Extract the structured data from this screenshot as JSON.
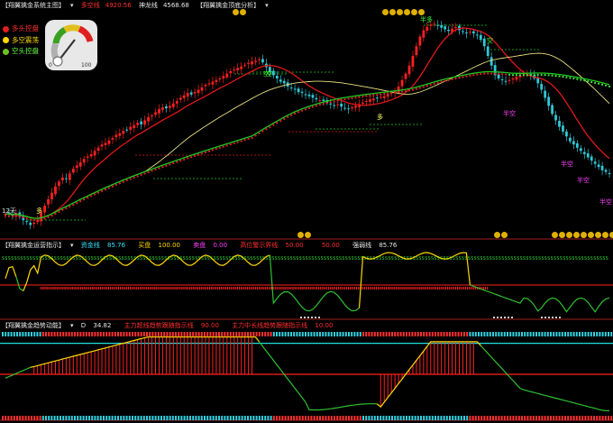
{
  "panel1": {
    "header": {
      "title": "【翔翼擒金系统主图】",
      "item1_label": "多空线",
      "item1_value": "4920.56",
      "item2_label": "神龙线",
      "item2_value": "4568.68",
      "subtitle": "【翔翼擒金顶底分析】"
    },
    "legend": [
      {
        "label": "多头控盘",
        "color": "#e02020"
      },
      {
        "label": "多空震荡",
        "color": "#ffd800"
      },
      {
        "label": "空头控盘",
        "color": "#6cc020"
      }
    ],
    "gauge": {
      "min": "0",
      "max": "100"
    },
    "timeframe": "12天",
    "annotations": [
      "多",
      "空",
      "多",
      "空",
      "半多",
      "空",
      "半空",
      "半空",
      "半空",
      "半空"
    ]
  },
  "panel2": {
    "header": {
      "title": "【翔翼擒金运营指示】",
      "items": [
        {
          "label": "资金线",
          "value": "85.76",
          "color": "#38e0ff"
        },
        {
          "label": "买盘",
          "value": "100.00",
          "color": "#ffd800"
        },
        {
          "label": "卖盘",
          "value": "0.00",
          "color": "#ff40ff"
        },
        {
          "label": "高位警示界线",
          "value": "50.00",
          "color": "#ff3030"
        },
        {
          "label": "",
          "value": "50.00",
          "color": "#ff3030"
        },
        {
          "label": "强弱线",
          "value": "85.76",
          "color": "#e6e6e6"
        }
      ]
    }
  },
  "panel3": {
    "header": {
      "title": "【翔翼擒金趋势动能】",
      "items": [
        {
          "label": "D",
          "value": "34.82",
          "color": "#e6e6e6"
        },
        {
          "label": "主力超线趋势跟随指示线",
          "value": "90.00",
          "color": "#ff3030"
        },
        {
          "label": "主力中长线趋势跟随指示线",
          "value": "10.00",
          "color": "#ff3030"
        }
      ]
    }
  },
  "colors": {
    "bg": "#000000",
    "up": "#ff2020",
    "down": "#30c8d8",
    "ma_red": "#e01818",
    "ma_green": "#20c820",
    "ma_yellow": "#e8e080",
    "dotline": "#e02020",
    "dotline_green": "#40e040",
    "osc_yellow": "#ffd800",
    "osc_green": "#30c030",
    "level_red": "#ff2020",
    "level_cyan": "#20e0e0",
    "sep": "#a02020"
  },
  "chart_data": {
    "type": "candlestick",
    "n_bars": 170,
    "y_range": [
      3900,
      5300
    ],
    "close": [
      4040,
      4035,
      4030,
      4045,
      4020,
      4000,
      3990,
      3970,
      3985,
      4000,
      4050,
      4090,
      4130,
      4170,
      4210,
      4240,
      4265,
      4255,
      4290,
      4320,
      4340,
      4360,
      4380,
      4395,
      4410,
      4430,
      4450,
      4470,
      4480,
      4495,
      4510,
      4530,
      4540,
      4555,
      4560,
      4580,
      4590,
      4605,
      4595,
      4620,
      4640,
      4650,
      4670,
      4690,
      4700,
      4695,
      4710,
      4725,
      4740,
      4760,
      4775,
      4790,
      4780,
      4795,
      4810,
      4825,
      4840,
      4850,
      4860,
      4870,
      4880,
      4895,
      4910,
      4925,
      4935,
      4945,
      4955,
      4965,
      4975,
      4985,
      4990,
      5000,
      4980,
      4950,
      4920,
      4900,
      4880,
      4860,
      4850,
      4830,
      4820,
      4810,
      4795,
      4790,
      4780,
      4770,
      4760,
      4750,
      4745,
      4740,
      4730,
      4720,
      4710,
      4720,
      4705,
      4695,
      4690,
      4700,
      4710,
      4720,
      4730,
      4740,
      4750,
      4755,
      4760,
      4765,
      4770,
      4780,
      4790,
      4800,
      4830,
      4870,
      4910,
      4960,
      5020,
      5080,
      5140,
      5180,
      5200,
      5215,
      5220,
      5210,
      5195,
      5185,
      5175,
      5190,
      5200,
      5180,
      5170,
      5160,
      5170,
      5160,
      5150,
      5120,
      5080,
      5020,
      4960,
      4900,
      4880,
      4870,
      4860,
      4870,
      4880,
      4890,
      4900,
      4910,
      4915,
      4900,
      4880,
      4850,
      4810,
      4760,
      4710,
      4660,
      4620,
      4580,
      4550,
      4520,
      4490,
      4470,
      4450,
      4430,
      4410,
      4390,
      4370,
      4350,
      4330,
      4310,
      4300,
      4290
    ]
  }
}
